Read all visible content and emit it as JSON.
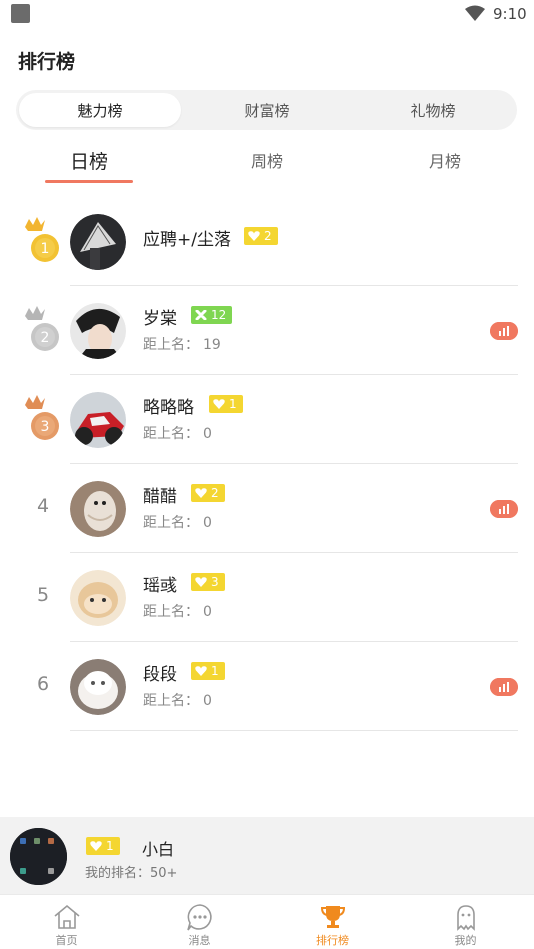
{
  "status_bar": {
    "time": "9:10"
  },
  "header": {
    "title": "排行榜"
  },
  "segments": [
    {
      "label": "魅力榜",
      "active": true
    },
    {
      "label": "财富榜",
      "active": false
    },
    {
      "label": "礼物榜",
      "active": false
    }
  ],
  "subtabs": [
    {
      "label": "日榜",
      "active": true
    },
    {
      "label": "周榜",
      "active": false
    },
    {
      "label": "月榜",
      "active": false
    }
  ],
  "rankings": [
    {
      "rank": "1",
      "name": "应聘+/尘落",
      "badge_value": "2",
      "badge_color": "#f4d631",
      "gap_label": "",
      "gap_value": "",
      "medal": "gold",
      "chart": false
    },
    {
      "rank": "2",
      "name": "岁棠",
      "badge_value": "12",
      "badge_color": "#7fd651",
      "gap_label": "距上名：",
      "gap_value": "19",
      "medal": "silver",
      "chart": true
    },
    {
      "rank": "3",
      "name": "略略略",
      "badge_value": "1",
      "badge_color": "#f4d631",
      "gap_label": "距上名：",
      "gap_value": "0",
      "medal": "bronze",
      "chart": false
    },
    {
      "rank": "4",
      "name": "醋醋",
      "badge_value": "2",
      "badge_color": "#f4d631",
      "gap_label": "距上名：",
      "gap_value": "0",
      "medal": "",
      "chart": true
    },
    {
      "rank": "5",
      "name": "瑶彧",
      "badge_value": "3",
      "badge_color": "#f4d631",
      "gap_label": "距上名：",
      "gap_value": "0",
      "medal": "",
      "chart": false
    },
    {
      "rank": "6",
      "name": "段段",
      "badge_value": "1",
      "badge_color": "#f4d631",
      "gap_label": "距上名：",
      "gap_value": "0",
      "medal": "",
      "chart": true
    }
  ],
  "me": {
    "badge_value": "1",
    "name": "小白",
    "rank_label": "我的排名：",
    "rank_value": "50+"
  },
  "tabbar": [
    {
      "label": "首页",
      "icon": "home-icon",
      "active": false
    },
    {
      "label": "消息",
      "icon": "message-icon",
      "active": false
    },
    {
      "label": "排行榜",
      "icon": "trophy-icon",
      "active": true
    },
    {
      "label": "我的",
      "icon": "ghost-icon",
      "active": false
    }
  ],
  "colors": {
    "accent": "#f07860",
    "tab_active": "#f08a1e",
    "badge_yellow": "#f4d631",
    "badge_green": "#7fd651",
    "gold": "#f2b530",
    "silver": "#bdbdbd",
    "bronze": "#e08d55"
  }
}
